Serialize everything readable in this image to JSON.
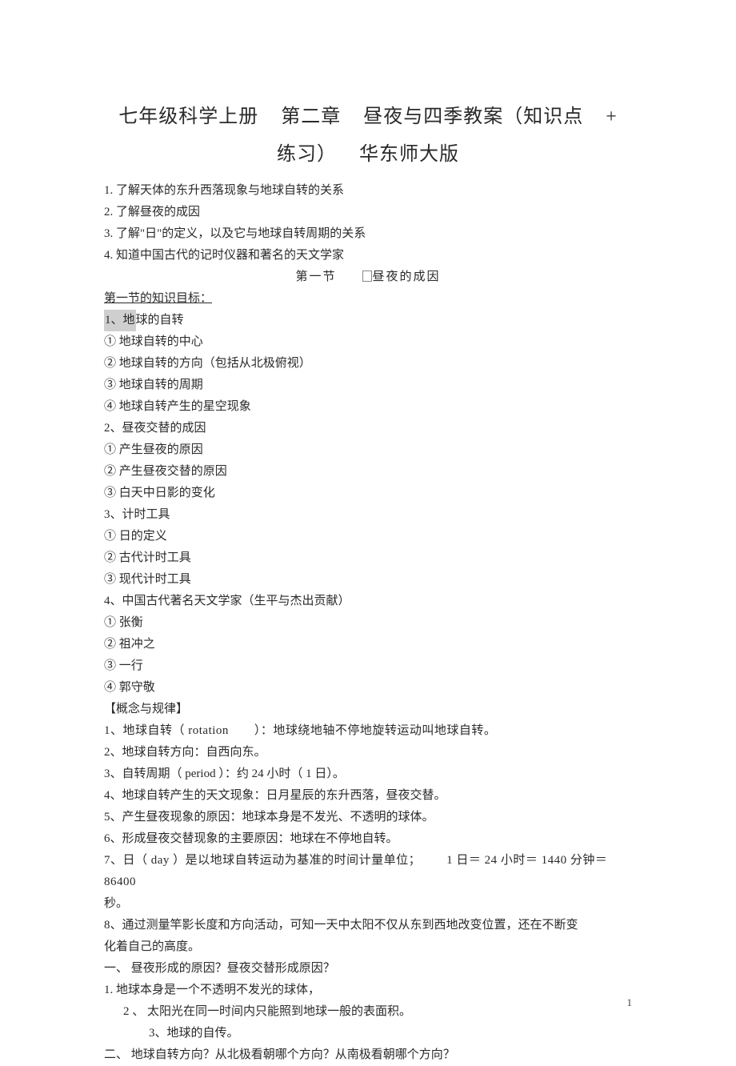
{
  "title": {
    "line1_a": "七年级科学上册",
    "line1_b": "第二章",
    "line1_c": "昼夜与四季教案（知识点",
    "line1_d": "+",
    "line2_a": "练习）",
    "line2_b": "华东师大版"
  },
  "intro": {
    "i1": "1. 了解天体的东升西落现象与地球自转的关系",
    "i2": "2. 了解昼夜的成因",
    "i3": "3. 了解\"日\"的定义，以及它与地球自转周期的关系",
    "i4": "4. 知道中国古代的记时仪器和著名的天文学家"
  },
  "sectionHeader": {
    "left": "第一节",
    "right": "昼夜的成因"
  },
  "goalsLabel": "第一节的知识目标：",
  "outline": {
    "h1": "1、地球的自转",
    "h1a": "① 地球自转的中心",
    "h1b": "② 地球自转的方向（包括从北极俯视）",
    "h1c": "③ 地球自转的周期",
    "h1d": "④ 地球自转产生的星空现象",
    "h2": "2、昼夜交替的成因",
    "h2a": "① 产生昼夜的原因",
    "h2b": "② 产生昼夜交替的原因",
    "h2c": "③ 白天中日影的变化",
    "h3": "3、计时工具",
    "h3a": "① 日的定义",
    "h3b": "② 古代计时工具",
    "h3c": "③ 现代计时工具",
    "h4": "4、中国古代著名天文学家（生平与杰出贡献）",
    "h4a": "① 张衡",
    "h4b": "② 祖冲之",
    "h4c": "③ 一行",
    "h4d": "④ 郭守敬"
  },
  "conceptsLabel": "【概念与规律】",
  "concepts": {
    "c1a": "1、地球自转（ rotation",
    "c1b": "）：地球绕地轴不停地旋转运动叫地球自转。",
    "c2": "2、地球自转方向：自西向东。",
    "c3": "3、自转周期（ period ）：约 24 小时（ 1 日）。",
    "c4": "4、地球自转产生的天文现象：日月星辰的东升西落，昼夜交替。",
    "c5": "5、产生昼夜现象的原因：地球本身是不发光、不透明的球体。",
    "c6": "6、形成昼夜交替现象的主要原因：地球在不停地自转。",
    "c7a": "7、日（ day ）是以地球自转运动为基准的时间计量单位；",
    "c7b": "1 日＝ 24 小时＝ 1440 分钟＝ 86400",
    "c7c": "秒。",
    "c8a": "8、通过测量竿影长度和方向活动，可知一天中太阳不仅从东到西地改变位置，还在不断变",
    "c8b": "化着自己的高度。"
  },
  "qa": {
    "q1": "一、 昼夜形成的原因？昼夜交替形成原因？",
    "q1a": "1. 地球本身是一个不透明不发光的球体，",
    "q1b": "2 、 太阳光在同一时间内只能照到地球一般的表面积。",
    "q1c": "3、地球的自传。",
    "q2": "二、 地球自转方向？从北极看朝哪个方向？从南极看朝哪个方向？"
  },
  "pageNumber": "1"
}
